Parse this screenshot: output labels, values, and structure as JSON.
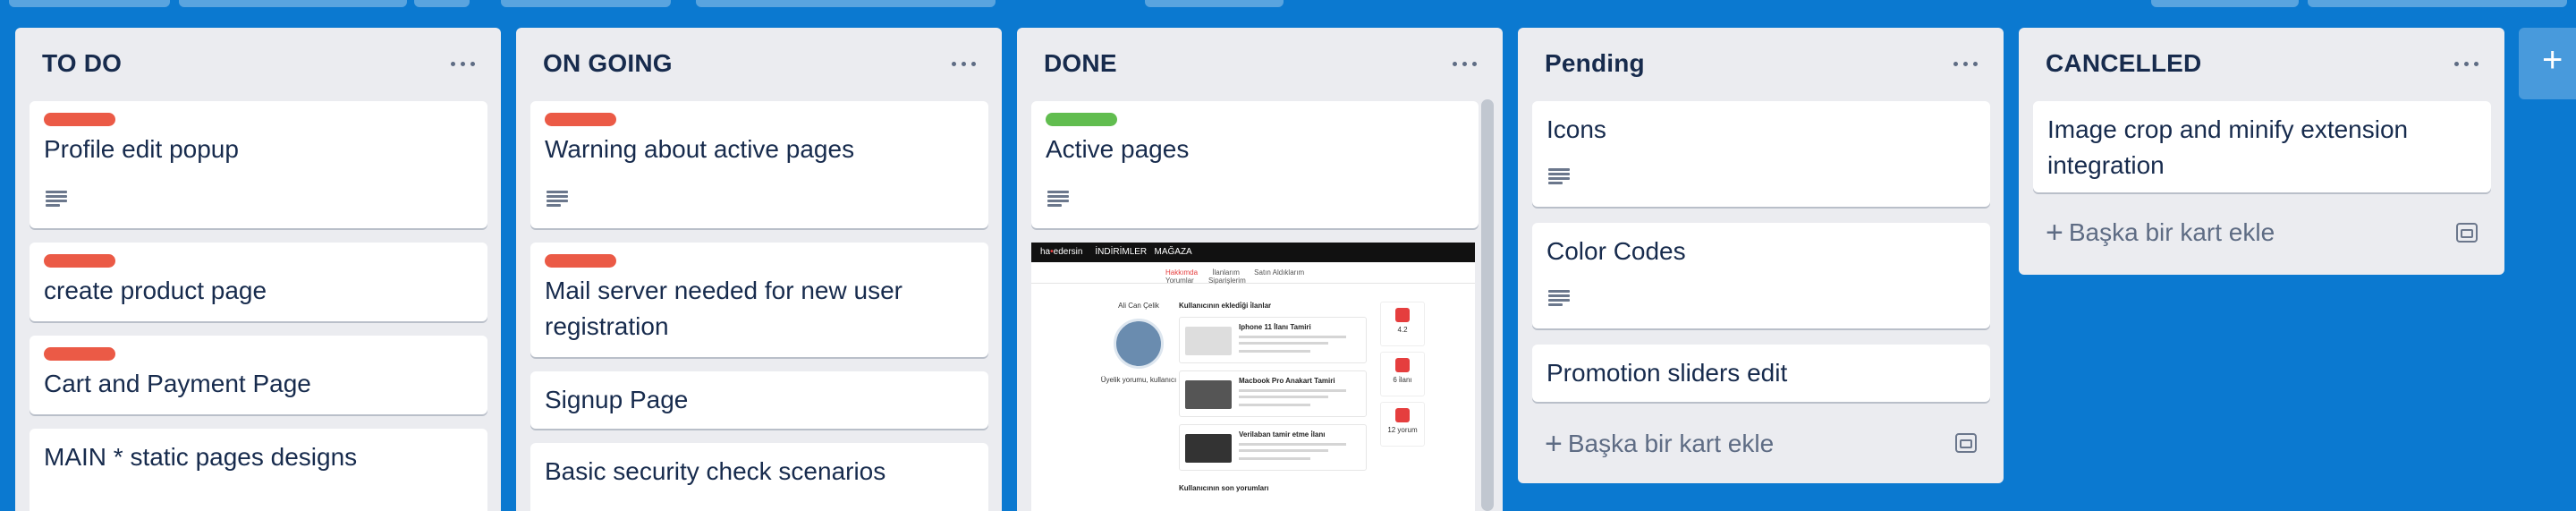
{
  "colors": {
    "board_bg": "#0b79d0",
    "label_red": "#eb5a46",
    "label_green": "#61bd4f"
  },
  "lists": [
    {
      "title": "TO DO",
      "cards": [
        {
          "label": "red",
          "title": "Profile edit popup",
          "has_description": true
        },
        {
          "label": "red",
          "title": "create product page",
          "has_description": false
        },
        {
          "label": "red",
          "title": "Cart and Payment Page",
          "has_description": false
        },
        {
          "label": null,
          "title": "MAIN * static pages designs",
          "has_description": false
        }
      ]
    },
    {
      "title": "ON GOING",
      "cards": [
        {
          "label": "red",
          "title": "Warning about active pages",
          "has_description": true
        },
        {
          "label": "red",
          "title": "Mail server needed for new user registration",
          "has_description": false
        },
        {
          "label": null,
          "title": "Signup Page",
          "has_description": false
        },
        {
          "label": null,
          "title": "Basic security check scenarios",
          "has_description": false
        }
      ]
    },
    {
      "title": "DONE",
      "cards": [
        {
          "label": "green",
          "title": "Active pages",
          "has_description": true
        }
      ],
      "attachment_preview": {
        "brand_left": "ha",
        "brand_accent": "•",
        "brand_right": "edersin",
        "nav_items": [
          "İNDİRİMLER",
          "MAĞAZA"
        ],
        "tabs": [
          "Hakkımda",
          "İlanlarım",
          "Satın Aldıklarım",
          "Yorumlar",
          "Siparişlerim"
        ],
        "profile_name": "Ali Can Çelik",
        "profile_meta": "Üyelik yorumu, kullanıcı",
        "feed_title": "Kullanıcının ekledi̇ği i̇lanlar",
        "feed_items": [
          "Iphone 11 İlanı Tamiri",
          "Macbook Pro Anakart Tamiri",
          "Verilaban tamir etme i̇lanı"
        ],
        "stats": [
          {
            "value": "4.2"
          },
          {
            "value": "6 i̇lanı"
          },
          {
            "value": "12 yorum"
          }
        ],
        "footer": "Kullanıcının son yorumları"
      }
    },
    {
      "title": "Pending",
      "cards": [
        {
          "label": null,
          "title": "Icons",
          "has_description": true
        },
        {
          "label": null,
          "title": "Color Codes",
          "has_description": true
        },
        {
          "label": null,
          "title": "Promotion sliders edit",
          "has_description": false
        }
      ],
      "add_card_label": "Başka bir kart ekle"
    },
    {
      "title": "CANCELLED",
      "cards": [
        {
          "label": null,
          "title": "Image crop and minify extension integration",
          "has_description": false
        }
      ],
      "add_card_label": "Başka bir kart ekle"
    }
  ],
  "add_list_icon": "plus-icon"
}
